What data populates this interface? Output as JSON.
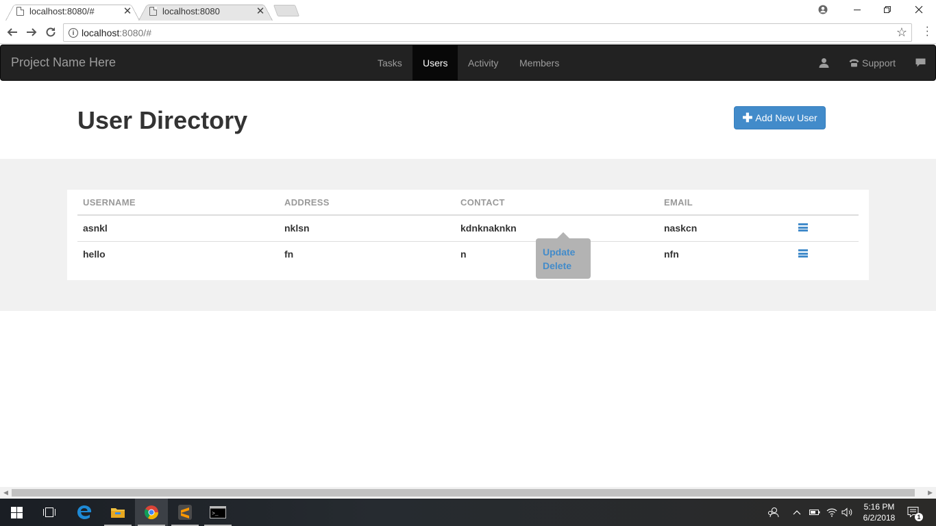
{
  "browser": {
    "tabs": [
      {
        "title": "localhost:8080/#",
        "active": true
      },
      {
        "title": "localhost:8080",
        "active": false
      }
    ],
    "url_host": "localhost",
    "url_rest": ":8080/#"
  },
  "navbar": {
    "brand": "Project Name Here",
    "items": [
      {
        "label": "Tasks",
        "active": false
      },
      {
        "label": "Users",
        "active": true
      },
      {
        "label": "Activity",
        "active": false
      },
      {
        "label": "Members",
        "active": false
      }
    ],
    "support_label": "Support"
  },
  "header": {
    "title": "User Directory",
    "add_button_label": "Add New User"
  },
  "table": {
    "columns": [
      "USERNAME",
      "ADDRESS",
      "CONTACT",
      "EMAIL"
    ],
    "rows": [
      {
        "username": "asnkl",
        "address": "nklsn",
        "contact": "kdnknaknkn",
        "email": "naskcn"
      },
      {
        "username": "hello",
        "address": "fn",
        "contact": "n",
        "email": "nfn"
      }
    ]
  },
  "popover": {
    "update_label": "Update",
    "delete_label": "Delete"
  },
  "taskbar": {
    "time": "5:16 PM",
    "date": "6/2/2018",
    "notification_count": "1"
  },
  "colors": {
    "primary": "#428bca",
    "navbar_bg": "#222222",
    "content_bg": "#f1f1f1"
  }
}
